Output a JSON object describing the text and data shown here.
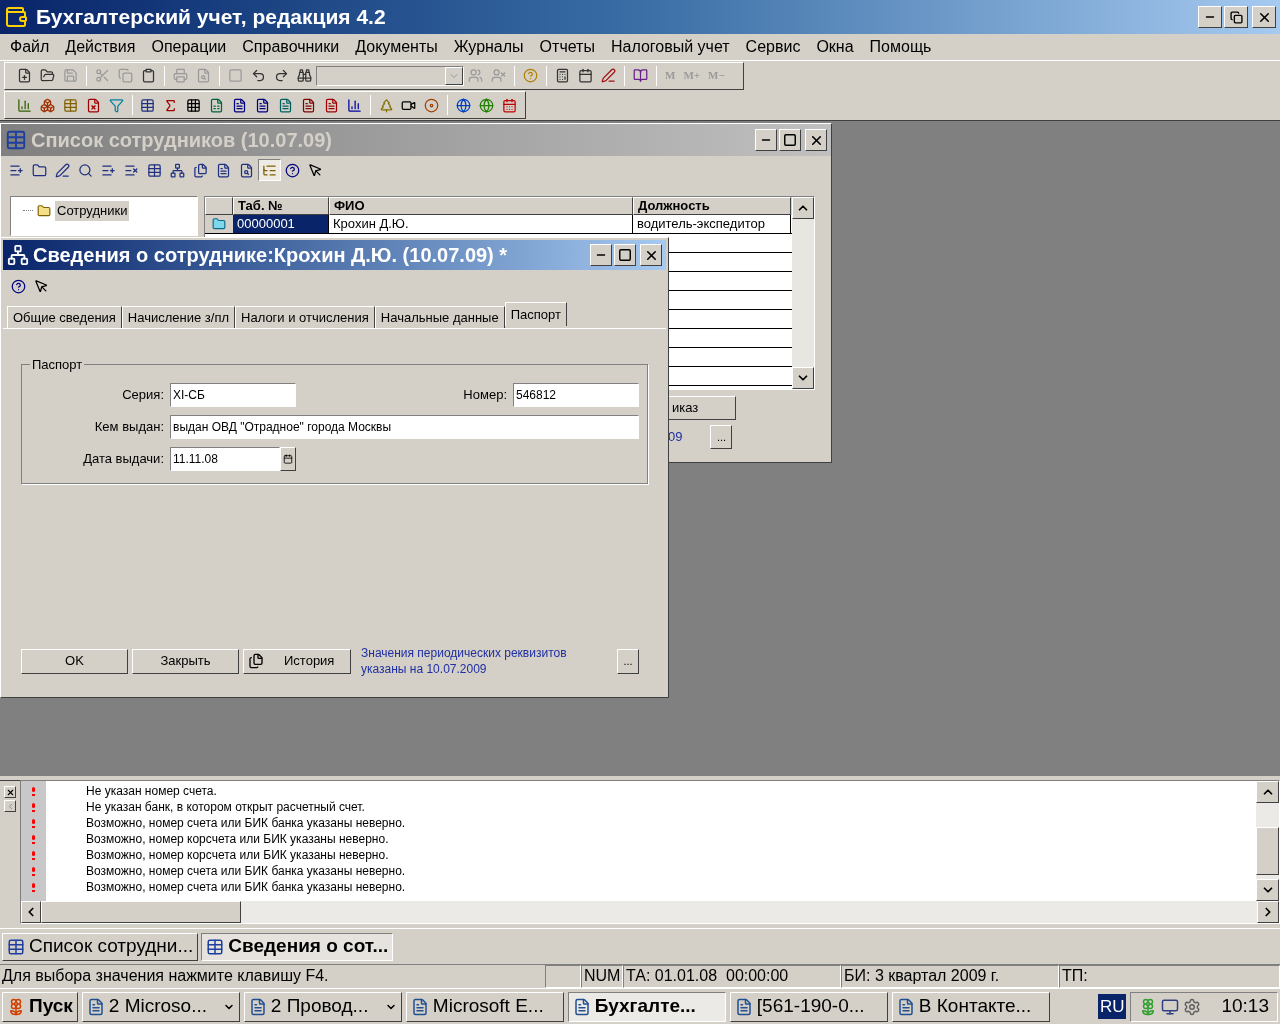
{
  "app_window": {
    "title": "Бухгалтерский учет, редакция 4.2"
  },
  "menu": [
    "Файл",
    "Действия",
    "Операции",
    "Справочники",
    "Документы",
    "Журналы",
    "Отчеты",
    "Налоговый учет",
    "Сервис",
    "Окна",
    "Помощь"
  ],
  "toolbar": {
    "memory_buttons": [
      {
        "label": "M",
        "disabled": true
      },
      {
        "label": "M+",
        "disabled": true
      },
      {
        "label": "M−",
        "disabled": true
      }
    ]
  },
  "list_window": {
    "title": "Список сотрудников (10.07.09)",
    "active": false,
    "tree_view_on": true,
    "tree": [
      {
        "label": "Сотрудники"
      }
    ],
    "columns": [
      "Таб. №",
      "ФИО",
      "Должность"
    ],
    "rows": [
      {
        "cells": [
          "00000001",
          "Крохин Д.Ю.",
          "водитель-экспедитор"
        ],
        "selected": true
      }
    ],
    "button_fragment": "иказ",
    "link_fragment": "09",
    "more_button": "..."
  },
  "details_window": {
    "title": "Сведения о сотруднике:Крохин Д.Ю. (10.07.09) *",
    "active": true,
    "tabs": [
      {
        "label": "Общие сведения",
        "selected": false
      },
      {
        "label": "Начисление з/пл",
        "selected": false
      },
      {
        "label": "Налоги и отчисления",
        "selected": false
      },
      {
        "label": "Начальные данные",
        "selected": false
      },
      {
        "label": "Паспорт",
        "selected": true
      }
    ],
    "group": {
      "title": "Паспорт",
      "rows": [
        {
          "fields": [
            {
              "label": "Серия:",
              "value": "XI-СБ",
              "kind": "text"
            },
            {
              "label": "Номер:",
              "value": "546812",
              "kind": "text"
            }
          ]
        },
        {
          "fields": [
            {
              "label": "Кем выдан:",
              "value": "выдан ОВД \"Отрадное\" города Москвы",
              "kind": "text"
            }
          ]
        },
        {
          "fields": [
            {
              "label": "Дата выдачи:",
              "value": "11.11.08",
              "kind": "date"
            }
          ]
        }
      ]
    },
    "buttons": [
      {
        "label": "OK",
        "kind": "plain"
      },
      {
        "label": "Закрыть",
        "kind": "plain"
      },
      {
        "label": "История",
        "kind": "history"
      }
    ],
    "note": "Значения периодических реквизитов указаны на 10.07.2009",
    "more_button": "..."
  },
  "messages": [
    {
      "kind": "warning",
      "text": "Не указан номер счета."
    },
    {
      "kind": "warning",
      "text": "Не указан банк, в котором открыт расчетный счет."
    },
    {
      "kind": "warning",
      "text": "Возможно, номер счета или БИК банка указаны неверно."
    },
    {
      "kind": "warning",
      "text": "Возможно, номер корсчета или БИК указаны неверно."
    },
    {
      "kind": "warning",
      "text": "Возможно, номер корсчета или БИК указаны неверно."
    },
    {
      "kind": "warning",
      "text": "Возможно, номер счета или БИК банка указаны неверно."
    },
    {
      "kind": "warning",
      "text": "Возможно, номер счета или БИК банка указаны неверно."
    }
  ],
  "window_tabs": [
    {
      "label": "Список сотрудни...",
      "selected": false
    },
    {
      "label": "Сведения о сот...",
      "selected": true
    }
  ],
  "status_bar": {
    "hint": "Для выбора значения нажмите клавишу F4.",
    "cells": [
      "NUM",
      "ТА: 01.01.08  00:00:00",
      "БИ: 3 квартал 2009 г.",
      "ТП:"
    ]
  },
  "taskbar": {
    "start": "Пуск",
    "items": [
      {
        "label": "2 Microso...",
        "group": true,
        "selected": false
      },
      {
        "label": "2 Провод...",
        "group": true,
        "selected": false
      },
      {
        "label": "Microsoft E...",
        "group": false,
        "selected": false
      },
      {
        "label": "Бухгалте...",
        "group": false,
        "selected": true
      },
      {
        "label": "[561-190-0...",
        "group": false,
        "selected": false
      },
      {
        "label": "В Контакте...",
        "group": false,
        "selected": false
      }
    ],
    "language": "RU",
    "clock": "10:13"
  }
}
